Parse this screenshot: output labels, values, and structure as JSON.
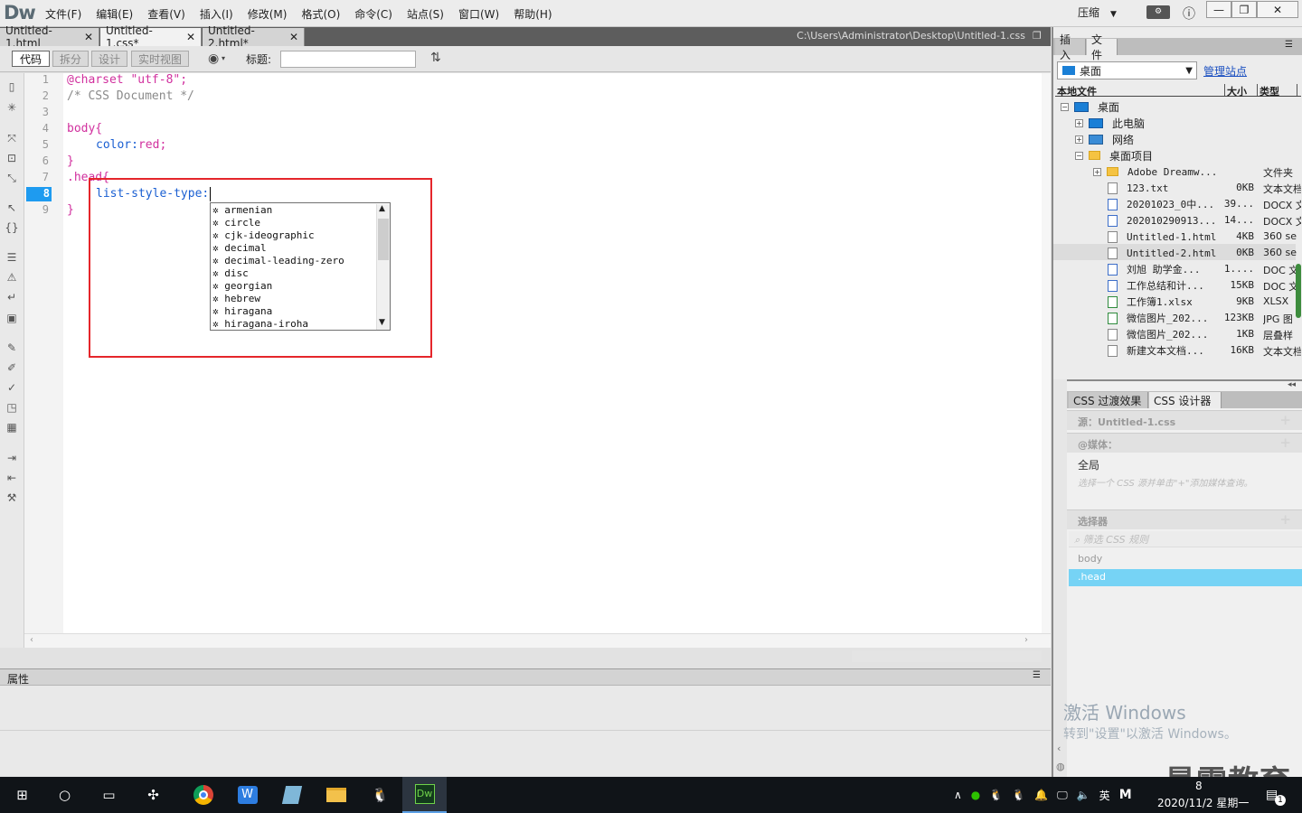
{
  "app": {
    "logo": "Dw",
    "compress_label": "压缩"
  },
  "menu": [
    "文件(F)",
    "编辑(E)",
    "查看(V)",
    "插入(I)",
    "修改(M)",
    "格式(O)",
    "命令(C)",
    "站点(S)",
    "窗口(W)",
    "帮助(H)"
  ],
  "tabs": [
    {
      "label": "Untitled-1.html",
      "active": false
    },
    {
      "label": "Untitled-1.css*",
      "active": true
    },
    {
      "label": "Untitled-2.html*",
      "active": false
    }
  ],
  "file_path": "C:\\Users\\Administrator\\Desktop\\Untitled-1.css",
  "toolbar": {
    "views": [
      "代码",
      "拆分",
      "设计",
      "实时视图"
    ],
    "title_label": "标题:",
    "title_value": ""
  },
  "editor": {
    "current_line": 8,
    "lines": [
      {
        "num": "1",
        "text": "@charset \"utf-8\";"
      },
      {
        "num": "2",
        "text": "/* CSS Document */"
      },
      {
        "num": "3",
        "text": ""
      },
      {
        "num": "4",
        "text": "body{"
      },
      {
        "num": "5",
        "prop": "color:",
        "value": "red;"
      },
      {
        "num": "6",
        "text": "}"
      },
      {
        "num": "7",
        "text": ".head{"
      },
      {
        "num": "8",
        "prop": "list-style-type:"
      },
      {
        "num": "9",
        "text": "}"
      }
    ],
    "hints": [
      "armenian",
      "circle",
      "cjk-ideographic",
      "decimal",
      "decimal-leading-zero",
      "disc",
      "georgian",
      "hebrew",
      "hiragana",
      "hiragana-iroha"
    ]
  },
  "properties_label": "属性",
  "files_panel": {
    "tabs": [
      "插入",
      "文件"
    ],
    "site": "桌面",
    "manage_link": "管理站点",
    "columns": [
      "本地文件",
      "大小",
      "类型"
    ],
    "root": "桌面",
    "nodes": [
      {
        "name": "此电脑",
        "kind": "pc"
      },
      {
        "name": "网络",
        "kind": "net"
      },
      {
        "name": "桌面项目",
        "kind": "folder"
      }
    ],
    "files": [
      {
        "name": "Adobe Dreamw...",
        "size": "",
        "type": "文件夹",
        "icon": "f"
      },
      {
        "name": "123.txt",
        "size": "0KB",
        "type": "文本文档",
        "icon": ""
      },
      {
        "name": "20201023_0中...",
        "size": "39...",
        "type": "DOCX 文",
        "icon": "w"
      },
      {
        "name": "202010290913...",
        "size": "14...",
        "type": "DOCX 文",
        "icon": "w"
      },
      {
        "name": "Untitled-1.html",
        "size": "4KB",
        "type": "360 se",
        "icon": ""
      },
      {
        "name": "Untitled-2.html",
        "size": "0KB",
        "type": "360 se",
        "icon": "",
        "selected": true
      },
      {
        "name": "刘旭 助学金...",
        "size": "1....",
        "type": "DOC 文",
        "icon": "w"
      },
      {
        "name": "工作总结和计...",
        "size": "15KB",
        "type": "DOC 文",
        "icon": "w"
      },
      {
        "name": "工作簿1.xlsx",
        "size": "9KB",
        "type": "XLSX",
        "icon": "x"
      },
      {
        "name": "微信图片_202...",
        "size": "123KB",
        "type": "JPG 图",
        "icon": ""
      },
      {
        "name": "微信图片_202...",
        "size": "1KB",
        "type": "层叠样",
        "icon": ""
      },
      {
        "name": "新建文本文档...",
        "size": "16KB",
        "type": "文本文档",
        "icon": ""
      }
    ]
  },
  "css_panel": {
    "tabs": [
      "CSS 过渡效果",
      "CSS 设计器"
    ],
    "source_label": "源：Untitled-1.css",
    "media_label": "@媒体：",
    "global": "全局",
    "media_note": "选择一个 CSS 源并单击\"+\"添加媒体查询。",
    "selectors_label": "选择器",
    "filter_placeholder": "筛选 CSS 规则",
    "selectors": [
      "body",
      ".head"
    ]
  },
  "activation": {
    "line1": "激活 Windows",
    "line2": "转到\"设置\"以激活 Windows。"
  },
  "watermark": "最需教育",
  "taskbar": {
    "ime": "英",
    "time": "8",
    "date": "2020/11/2 星期一",
    "notify_count": "1"
  }
}
